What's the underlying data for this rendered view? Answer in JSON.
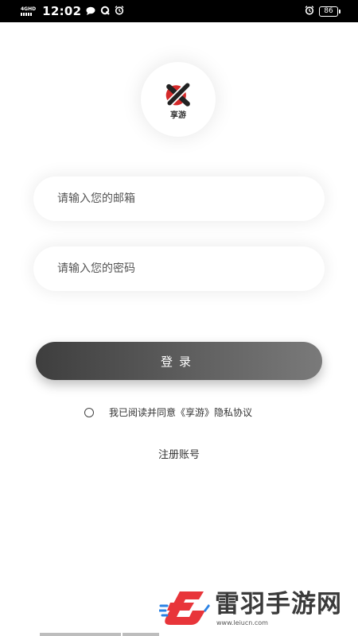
{
  "status_bar": {
    "network_type": "4GHD",
    "time": "12:02",
    "battery": "86",
    "left_icons": [
      "chat-bubble-icon",
      "q-app-icon",
      "alarm-clock-icon"
    ],
    "right_icons": [
      "alarm-clock-icon"
    ]
  },
  "logo": {
    "text": "享游",
    "accent_color": "#d42a2a"
  },
  "form": {
    "email_placeholder": "请输入您的邮箱",
    "email_value": "",
    "password_placeholder": "请输入您的密码",
    "password_value": ""
  },
  "login_button": {
    "label": "登录"
  },
  "agreement": {
    "checked": false,
    "text": "我已阅读并同意《享游》隐私协议"
  },
  "register_link": {
    "label": "注册账号"
  },
  "watermark": {
    "name": "雷羽手游网",
    "url": "www.leiucn.com",
    "brand_color": "#e8353a"
  },
  "colors": {
    "button_dark": "#3e3e3e",
    "button_light": "#7a7a7a",
    "background": "#ffffff"
  }
}
